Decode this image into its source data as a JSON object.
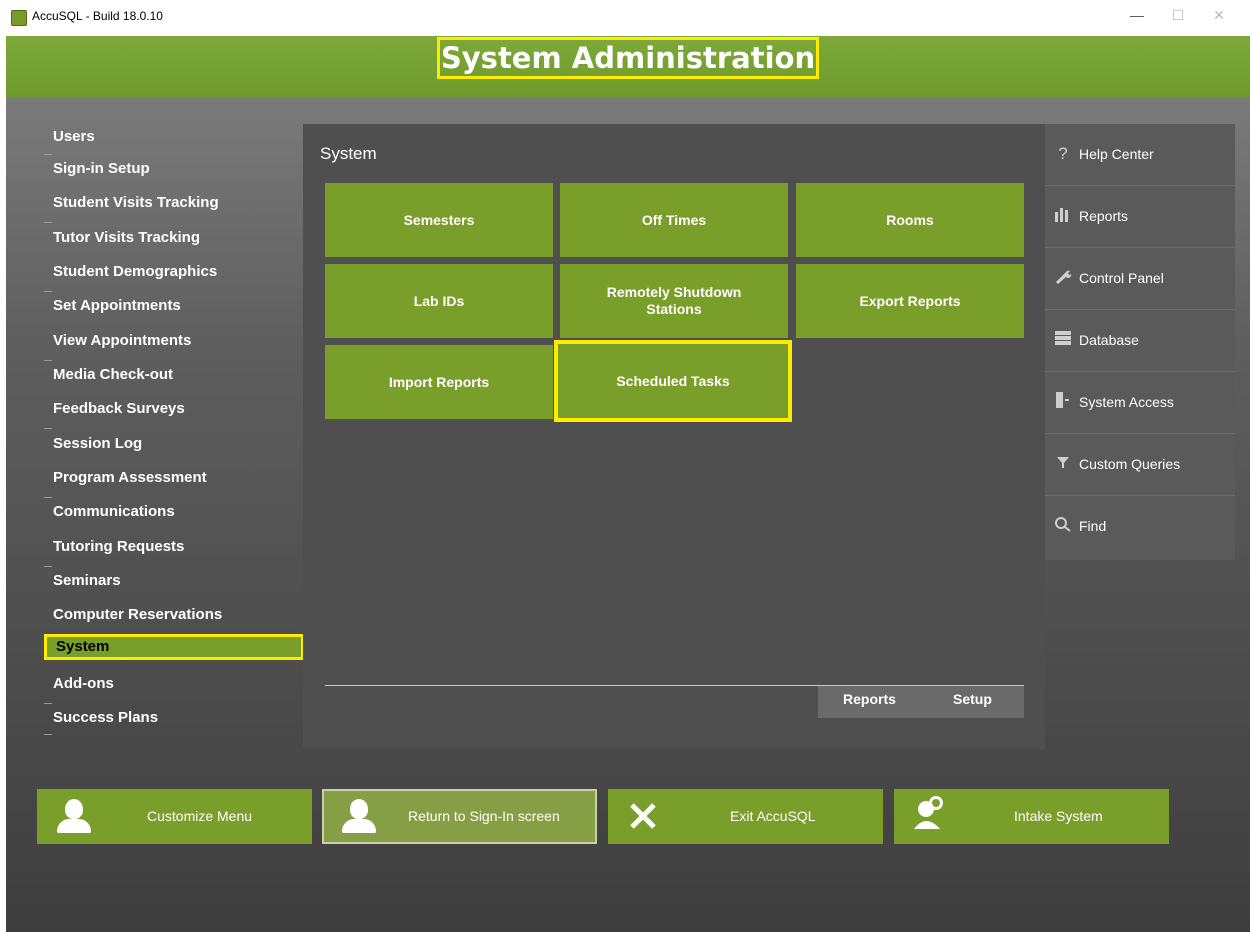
{
  "window": {
    "title": "AccuSQL - Build 18.0.10"
  },
  "header": {
    "title": "System Administration"
  },
  "sidebar": {
    "items": [
      {
        "label": "Users"
      },
      {
        "label": "Sign-in Setup"
      },
      {
        "label": "Student Visits Tracking"
      },
      {
        "label": "Tutor Visits Tracking"
      },
      {
        "label": "Student Demographics"
      },
      {
        "label": "Set Appointments"
      },
      {
        "label": "View Appointments"
      },
      {
        "label": "Media Check-out"
      },
      {
        "label": "Feedback Surveys"
      },
      {
        "label": "Session Log"
      },
      {
        "label": "Program Assessment"
      },
      {
        "label": "Communications"
      },
      {
        "label": "Tutoring Requests"
      },
      {
        "label": "Seminars"
      },
      {
        "label": "Computer Reservations"
      },
      {
        "label": "System"
      },
      {
        "label": "Add-ons"
      },
      {
        "label": "Success Plans"
      }
    ],
    "active": "System"
  },
  "panel": {
    "title": "System",
    "tiles": [
      {
        "label": "Semesters"
      },
      {
        "label": "Off Times"
      },
      {
        "label": "Rooms"
      },
      {
        "label": "Lab IDs"
      },
      {
        "label": "Remotely Shutdown Stations"
      },
      {
        "label": "Export Reports"
      },
      {
        "label": "Import Reports"
      },
      {
        "label": "Scheduled Tasks"
      }
    ],
    "tabs": [
      {
        "label": "Reports"
      },
      {
        "label": "Setup"
      }
    ]
  },
  "right_menu": {
    "items": [
      {
        "label": "Help Center",
        "icon": "question-icon"
      },
      {
        "label": "Reports",
        "icon": "bar-chart-icon"
      },
      {
        "label": "Control Panel",
        "icon": "wrench-icon"
      },
      {
        "label": "Database",
        "icon": "database-icon"
      },
      {
        "label": "System Access",
        "icon": "door-icon"
      },
      {
        "label": "Custom Queries",
        "icon": "filter-icon"
      },
      {
        "label": "Find",
        "icon": "search-icon"
      }
    ]
  },
  "bottom_bar": {
    "customize": {
      "label": "Customize Menu",
      "icon": "person-icon"
    },
    "return": {
      "label": "Return to Sign-In screen",
      "icon": "person-icon"
    },
    "exit": {
      "label": "Exit AccuSQL",
      "icon": "close-icon"
    },
    "intake": {
      "label": "Intake System",
      "icon": "intake-person-icon"
    }
  },
  "colors": {
    "accent_green": "#7a9e2a",
    "highlight_yellow": "#ffeb00",
    "panel_gray": "#4f4f4f"
  }
}
